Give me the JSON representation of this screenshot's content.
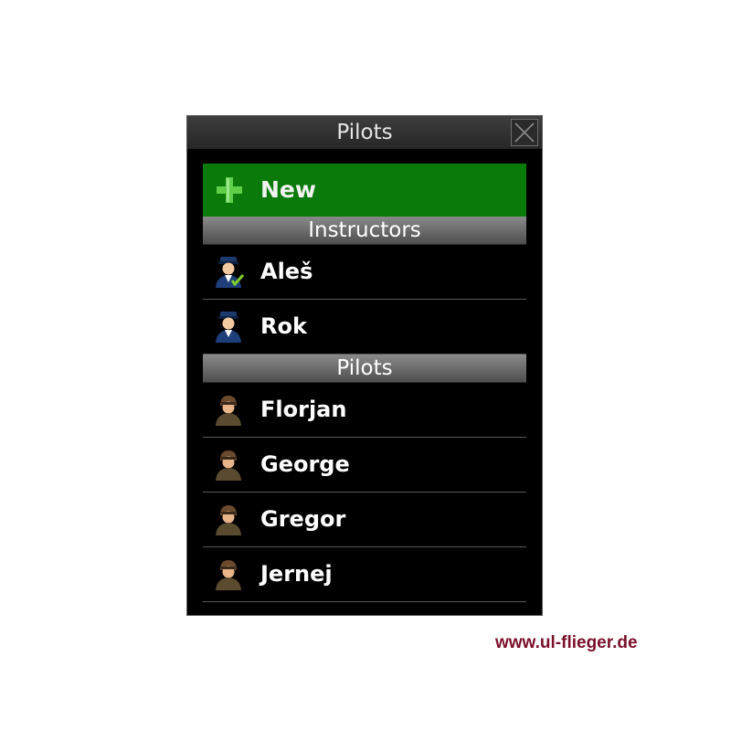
{
  "window": {
    "title": "Pilots"
  },
  "new_button": {
    "label": "New",
    "icon": "plus-icon"
  },
  "sections": [
    {
      "label": "Instructors",
      "items": [
        "Aleš",
        "Rok"
      ]
    },
    {
      "label": "Pilots",
      "items": [
        "Florjan",
        "George",
        "Gregor",
        "Jernej"
      ]
    }
  ],
  "watermark": "www.ul-flieger.de",
  "colors": {
    "new_bg": "#0a7a0a",
    "accent_plus": "#5fcf4a",
    "watermark": "#7a0f2a"
  }
}
